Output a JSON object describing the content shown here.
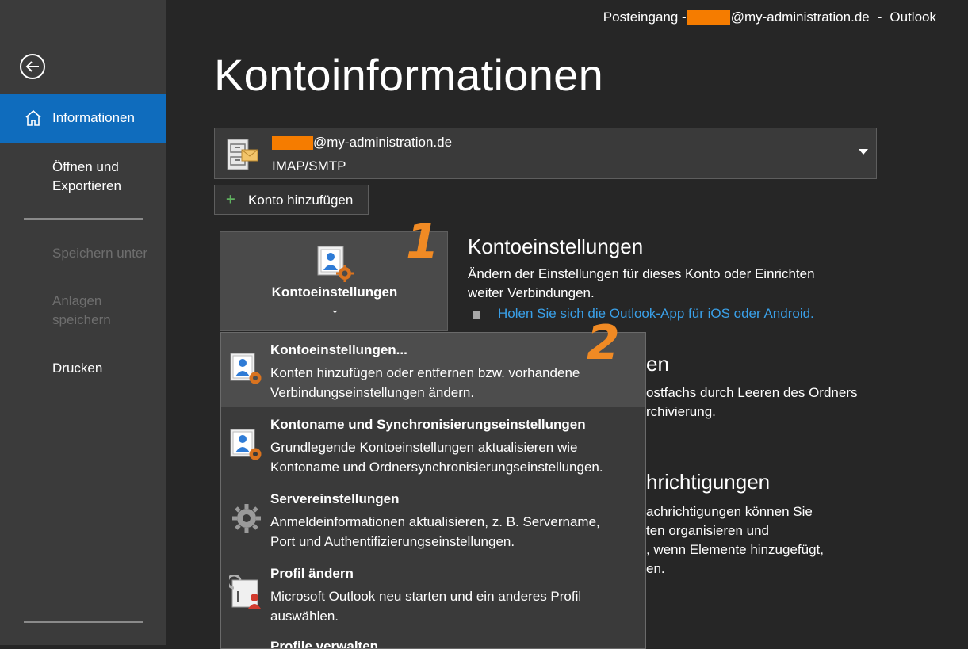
{
  "window": {
    "title_prefix": "Posteingang -",
    "title_email_domain": "@my-administration.de",
    "title_sep": "-",
    "title_app": "Outlook"
  },
  "sidebar": {
    "items": [
      {
        "label": "Informationen",
        "active": true
      },
      {
        "label": "Öffnen und\nExportieren"
      },
      {
        "label": "Speichern unter",
        "disabled": true
      },
      {
        "label": "Anlagen\nspeichern",
        "disabled": true
      },
      {
        "label": "Drucken"
      }
    ]
  },
  "page": {
    "title": "Kontoinformationen"
  },
  "account": {
    "email_domain": "@my-administration.de",
    "type": "IMAP/SMTP"
  },
  "add_account": {
    "label": "Konto hinzufügen"
  },
  "settings_tile": {
    "label": "Kontoeinstellungen",
    "chevron": "⌄"
  },
  "annotations": {
    "one": "1",
    "two": "2"
  },
  "section_account_settings": {
    "heading": "Kontoeinstellungen",
    "text_line1": "Ändern der Einstellungen für dieses Konto oder Einrichten",
    "text_line2": "weiter Verbindungen.",
    "link": "Holen Sie sich die Outlook-App für iOS oder Android."
  },
  "background_fragments": {
    "h2": "en",
    "p2_line1": "ostfachs durch Leeren des Ordners",
    "p2_line2": "rchivierung.",
    "h3": "hrichtigungen",
    "p3_line1": "achrichtigungen können Sie",
    "p3_line2": "ten organisieren und",
    "p3_line3": ", wenn Elemente hinzugefügt,",
    "p3_line4": "en."
  },
  "dropdown": {
    "items": [
      {
        "title": "Kontoeinstellungen...",
        "desc1": "Konten hinzufügen oder entfernen bzw. vorhandene",
        "desc2": "Verbindungseinstellungen ändern.",
        "icon": "account-settings-icon"
      },
      {
        "title": "Kontoname und Synchronisierungseinstellungen",
        "desc1": "Grundlegende Kontoeinstellungen aktualisieren wie",
        "desc2": "Kontoname und Ordnersynchronisierungseinstellungen.",
        "icon": "account-sync-icon"
      },
      {
        "title": "Servereinstellungen",
        "desc1": "Anmeldeinformationen aktualisieren, z. B. Servername,",
        "desc2": "Port und Authentifizierungseinstellungen.",
        "icon": "gear-icon"
      },
      {
        "title": "Profil ändern",
        "desc1": "Microsoft Outlook neu starten und ein anderes Profil",
        "desc2": "auswählen.",
        "icon": "change-profile-icon"
      },
      {
        "title": "Profile verwalten",
        "icon": "manage-profiles-icon"
      }
    ]
  },
  "colors": {
    "sidebar_bg": "#3b3b3b",
    "main_bg": "#262626",
    "accent_blue": "#0f6cbd",
    "redaction": "#f57c00",
    "annotation": "#f08a24",
    "link": "#3aa0e8"
  }
}
